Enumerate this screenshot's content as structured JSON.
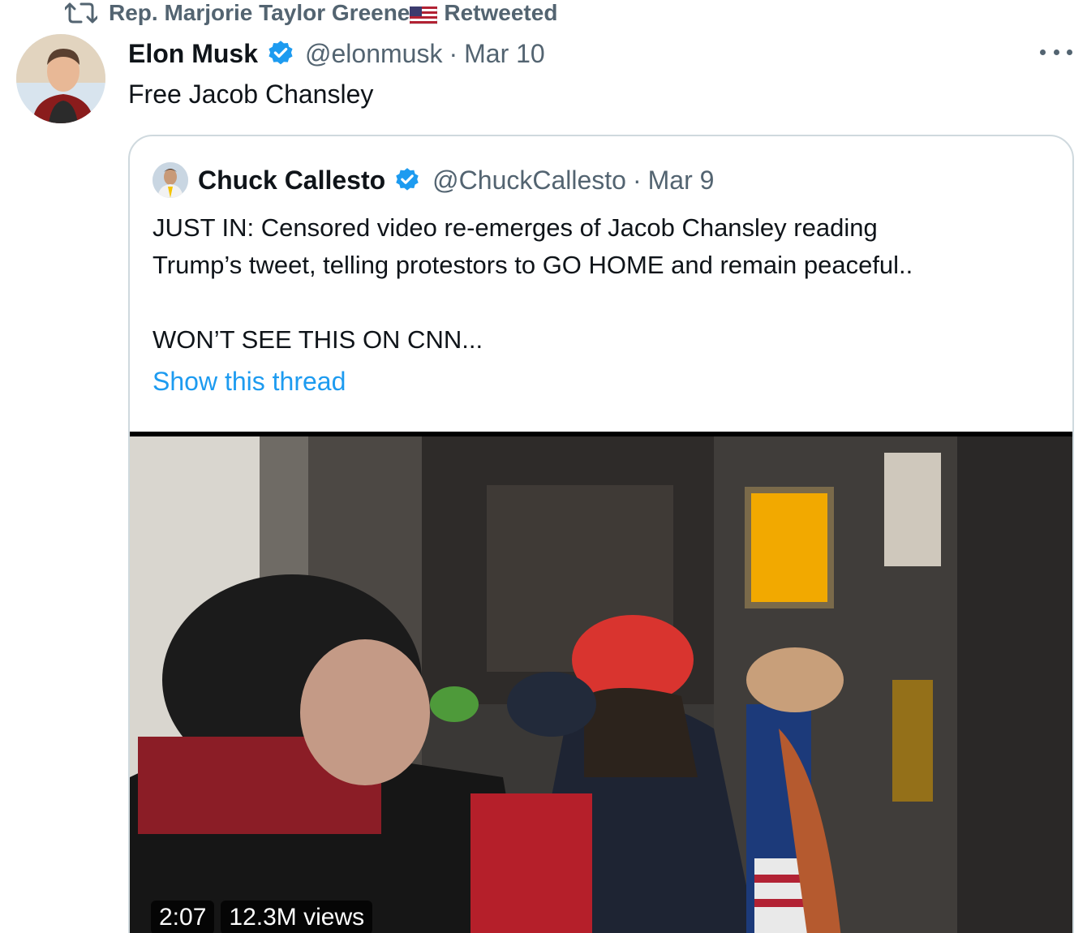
{
  "retweet_context": {
    "retweeter": "Rep. Marjorie Taylor Greene",
    "label": "Retweeted"
  },
  "tweet": {
    "display_name": "Elon Musk",
    "handle": "@elonmusk",
    "separator": "·",
    "date": "Mar 10",
    "text": "Free Jacob Chansley"
  },
  "quote": {
    "display_name": "Chuck Callesto",
    "handle": "@ChuckCallesto",
    "separator": "·",
    "date": "Mar 9",
    "line1": "JUST IN: Censored video re-emerges of Jacob Chansley reading",
    "line2": "Trump’s tweet, telling protestors to GO HOME and remain peaceful..",
    "line3": "WON’T SEE THIS ON CNN...",
    "show_thread": "Show this thread",
    "video": {
      "duration": "2:07",
      "views": "12.3M views"
    }
  },
  "colors": {
    "secondary_text": "#536471",
    "link_blue": "#1d9bf0",
    "verified_blue": "#1d9bf0",
    "border": "#cfd9de"
  }
}
